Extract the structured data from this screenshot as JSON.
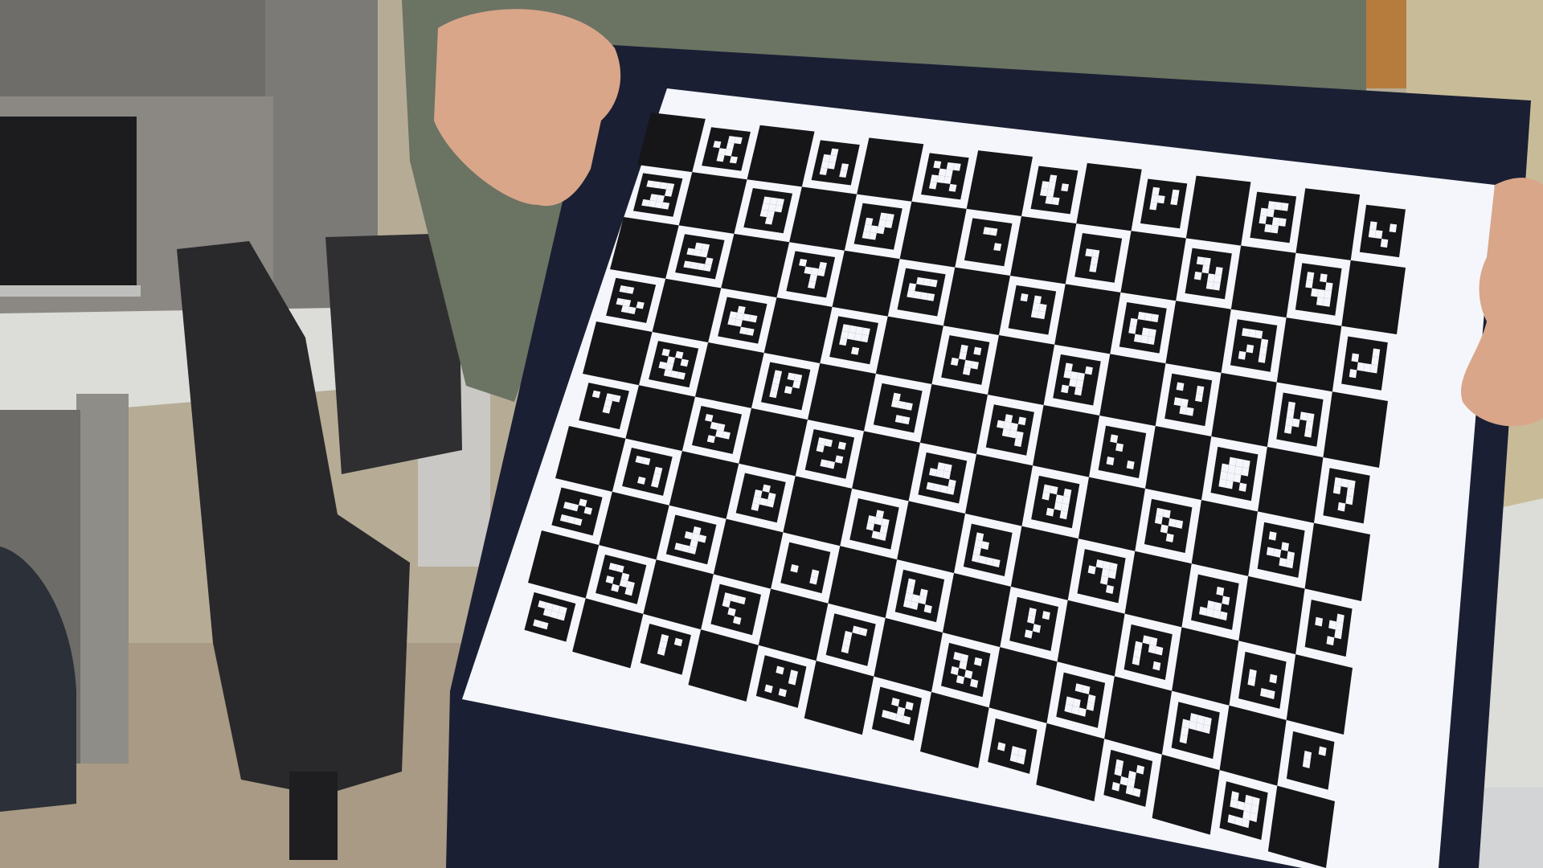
{
  "image": {
    "description_tags": [
      "office",
      "charuco-calibration-board",
      "hands",
      "office-chair",
      "desk",
      "monitor"
    ]
  },
  "board": {
    "rows": 10,
    "cols": 14,
    "marker_dictionary": "aruco",
    "paper_color": "#f4f6fb",
    "square_color": "#161618",
    "frame_color": "#1b1f33"
  },
  "colors": {
    "wall": "#b9b09a",
    "floor": "#a89a84",
    "chair": "#2a2a2d",
    "desk": "#d9d9d6",
    "cabinet": "#7d7a76",
    "shirt": "#6e7565",
    "skin": "#d9a689",
    "monitor": "#1c1c1e"
  }
}
